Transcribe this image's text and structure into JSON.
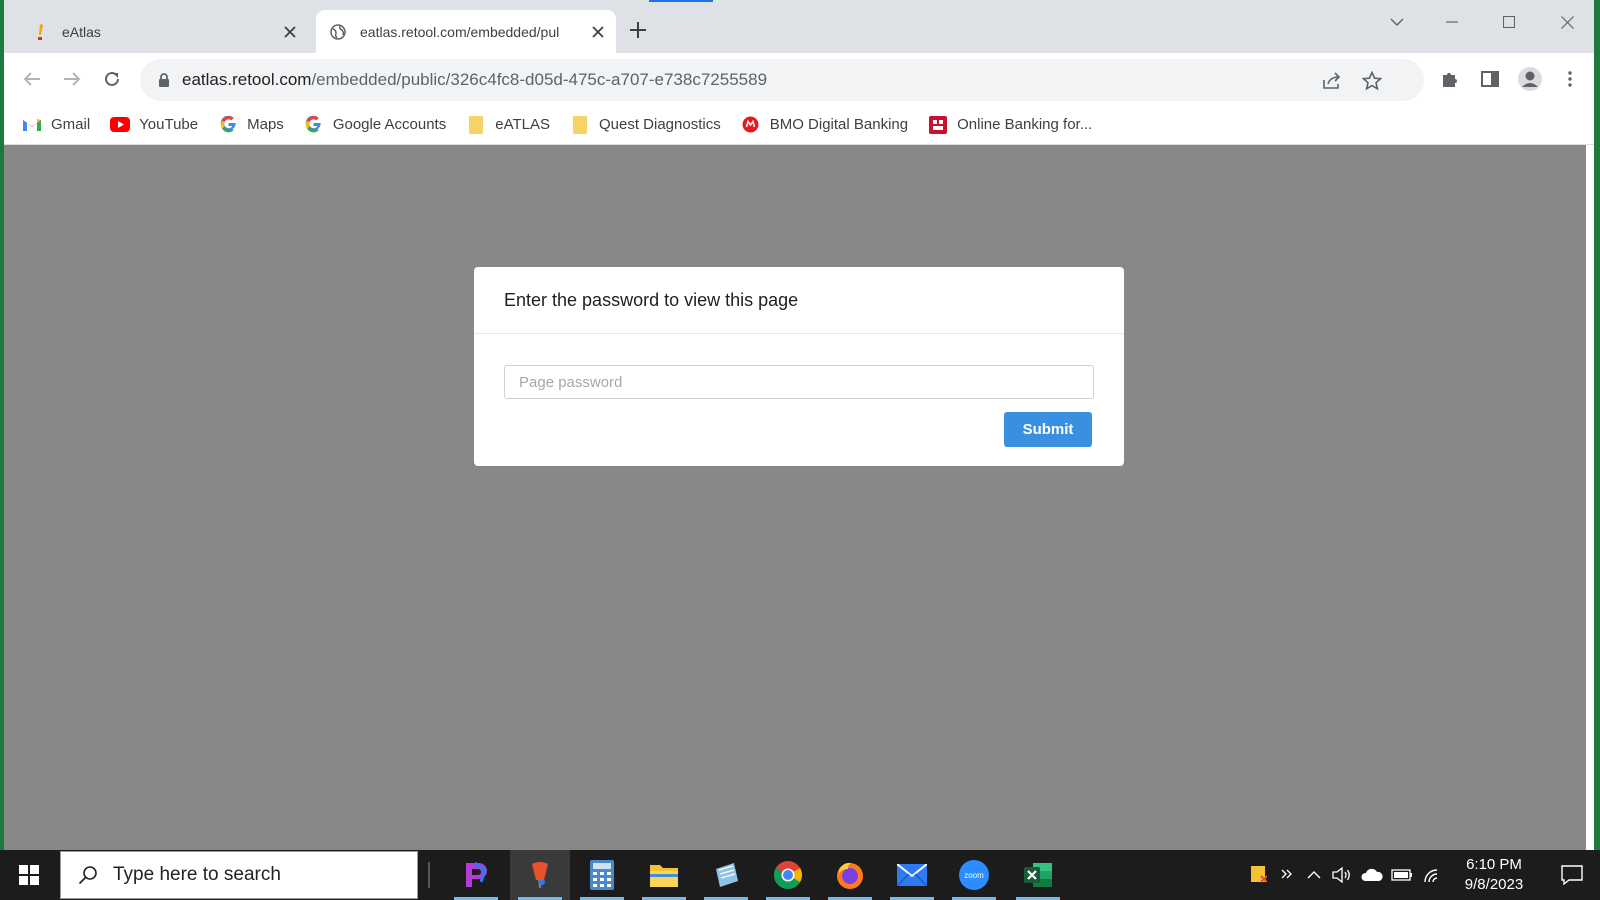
{
  "browser": {
    "tabs": [
      {
        "title": "eAtlas",
        "active": false
      },
      {
        "title": "eatlas.retool.com/embedded/pul",
        "active": true
      }
    ],
    "address_bar": {
      "host": "eatlas.retool.com",
      "path": "/embedded/public/326c4fc8-d05d-475c-a707-e738c7255589"
    },
    "bookmarks": [
      {
        "label": "Gmail",
        "icon": "gmail-icon"
      },
      {
        "label": "YouTube",
        "icon": "youtube-icon"
      },
      {
        "label": "Maps",
        "icon": "google-icon"
      },
      {
        "label": "Google Accounts",
        "icon": "google-icon"
      },
      {
        "label": "eATLAS",
        "icon": "folder-icon"
      },
      {
        "label": "Quest Diagnostics",
        "icon": "folder-icon"
      },
      {
        "label": "BMO Digital Banking",
        "icon": "bmo-icon"
      },
      {
        "label": "Online Banking for...",
        "icon": "bank-icon"
      }
    ]
  },
  "dialog": {
    "title": "Enter the password to view this page",
    "password_placeholder": "Page password",
    "submit_label": "Submit"
  },
  "taskbar": {
    "search_placeholder": "Type here to search",
    "apps": [
      "photoshop-express-icon",
      "paint-icon",
      "calculator-icon",
      "file-explorer-icon",
      "notepad-icon",
      "chrome-icon",
      "firefox-icon",
      "mail-icon",
      "zoom-icon",
      "excel-icon"
    ],
    "zoom_label": "zoom",
    "time": "6:10 PM",
    "date": "9/8/2023"
  },
  "colors": {
    "accent": "#1a73e8",
    "submit_button": "#3b8fe0",
    "content_background": "#888888",
    "taskbar": "#1c1c1c"
  }
}
